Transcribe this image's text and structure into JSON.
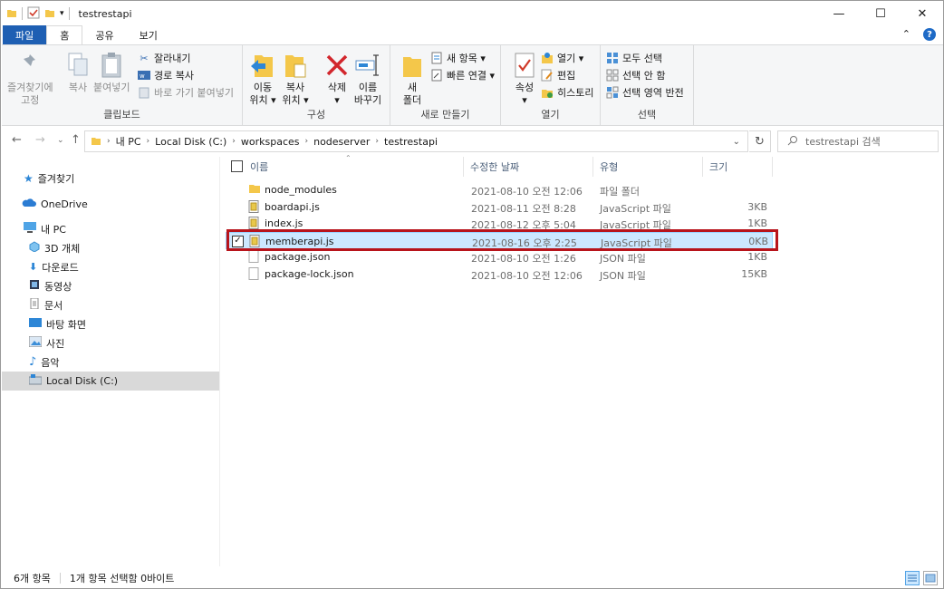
{
  "window": {
    "title": "testrestapi",
    "controls": {
      "minimize": "—",
      "maximize": "☐",
      "close": "✕"
    }
  },
  "tabs": [
    "파일",
    "홈",
    "공유",
    "보기"
  ],
  "ribbon": {
    "clipboard": {
      "label": "클립보드",
      "pin": [
        "즐겨찾기에",
        "고정"
      ],
      "copy": "복사",
      "paste": "붙여넣기",
      "cut": "잘라내기",
      "copy_path": "경로 복사",
      "paste_shortcut": "바로 가기 붙여넣기"
    },
    "organize": {
      "label": "구성",
      "move": [
        "이동",
        "위치 ▾"
      ],
      "copyto": [
        "복사",
        "위치 ▾"
      ],
      "delete": [
        "삭제",
        "▾"
      ],
      "rename": [
        "이름",
        "바꾸기"
      ]
    },
    "new": {
      "label": "새로 만들기",
      "new_folder": [
        "새",
        "폴더"
      ],
      "new_item": "새 항목 ▾",
      "easy_access": "빠른 연결 ▾"
    },
    "open": {
      "label": "열기",
      "properties": [
        "속성",
        "▾"
      ],
      "open": "열기 ▾",
      "edit": "편집",
      "history": "히스토리"
    },
    "select": {
      "label": "선택",
      "select_all": "모두 선택",
      "select_none": "선택 안 함",
      "invert": "선택 영역 반전"
    }
  },
  "address": {
    "crumbs": [
      "내 PC",
      "Local Disk (C:)",
      "workspaces",
      "nodeserver",
      "testrestapi"
    ],
    "search_placeholder": "testrestapi 검색"
  },
  "nav": {
    "quick_access": "즐겨찾기",
    "onedrive": "OneDrive",
    "this_pc": "내 PC",
    "items": [
      "3D 개체",
      "다운로드",
      "동영상",
      "문서",
      "바탕 화면",
      "사진",
      "음악",
      "Local Disk (C:)"
    ]
  },
  "columns": {
    "name": "이름",
    "date": "수정한 날짜",
    "type": "유형",
    "size": "크기"
  },
  "files": [
    {
      "name": "node_modules",
      "date": "2021-08-10 오전 12:06",
      "type": "파일 폴더",
      "size": "",
      "icon": "folder"
    },
    {
      "name": "boardapi.js",
      "date": "2021-08-11 오전 8:28",
      "type": "JavaScript 파일",
      "size": "3KB",
      "icon": "js"
    },
    {
      "name": "index.js",
      "date": "2021-08-12 오후 5:04",
      "type": "JavaScript 파일",
      "size": "1KB",
      "icon": "js"
    },
    {
      "name": "memberapi.js",
      "date": "2021-08-16 오후 2:25",
      "type": "JavaScript 파일",
      "size": "0KB",
      "icon": "js",
      "selected": true
    },
    {
      "name": "package.json",
      "date": "2021-08-10 오전 1:26",
      "type": "JSON 파일",
      "size": "1KB",
      "icon": "file"
    },
    {
      "name": "package-lock.json",
      "date": "2021-08-10 오전 12:06",
      "type": "JSON 파일",
      "size": "15KB",
      "icon": "file"
    }
  ],
  "status": {
    "count": "6개 항목",
    "selection": "1개 항목 선택함 0바이트"
  },
  "colors": {
    "accent": "#1e5fb3",
    "selection": "#cce8ff",
    "highlight": "#b8141b"
  }
}
